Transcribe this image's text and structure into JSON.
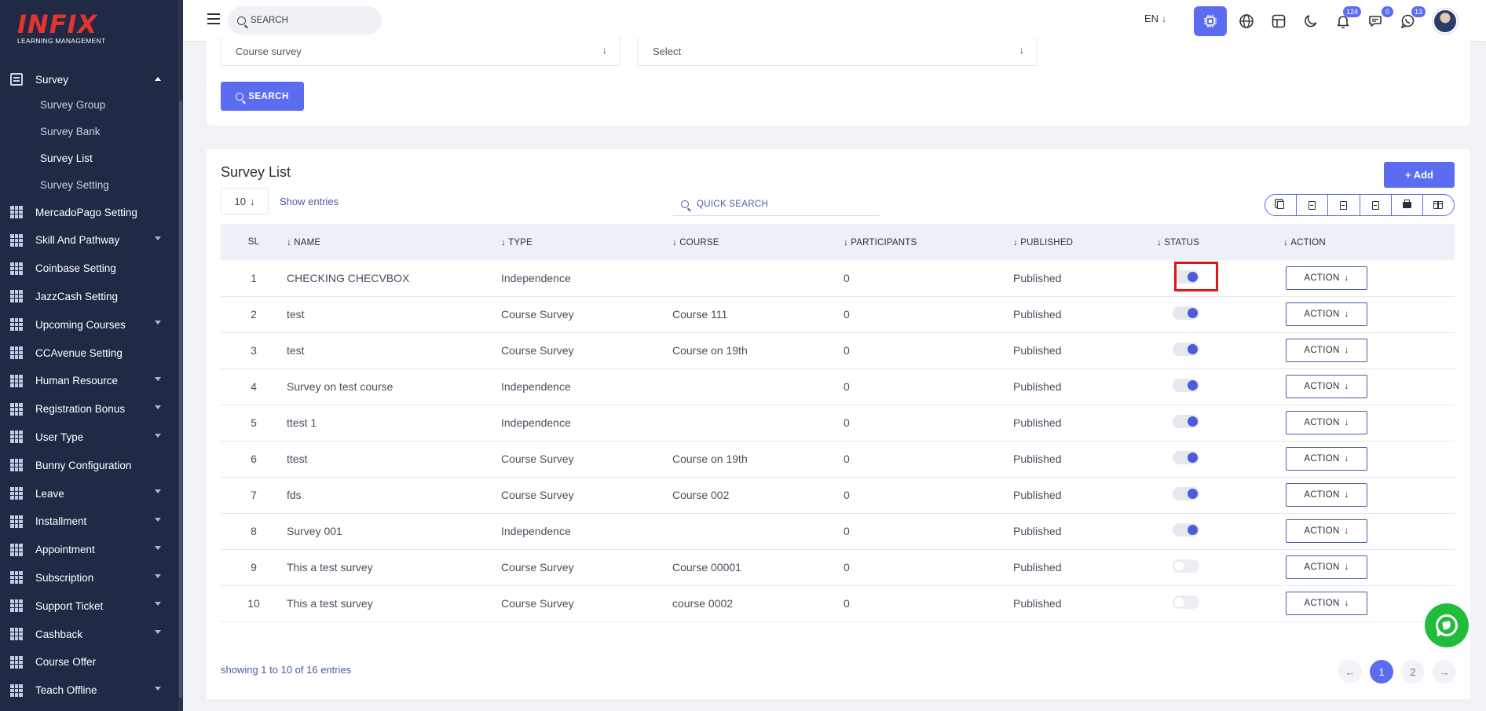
{
  "brand": {
    "name": "INFIX",
    "tagline": "LEARNING MANAGEMENT"
  },
  "sidebar": {
    "group": {
      "label": "Survey",
      "icon": "document-icon"
    },
    "sub_items": [
      {
        "label": "Survey Group",
        "active": false
      },
      {
        "label": "Survey Bank",
        "active": false
      },
      {
        "label": "Survey List",
        "active": true
      },
      {
        "label": "Survey Setting",
        "active": false
      }
    ],
    "items": [
      {
        "label": "MercadoPago Setting",
        "has_caret": false
      },
      {
        "label": "Skill And Pathway",
        "has_caret": true
      },
      {
        "label": "Coinbase Setting",
        "has_caret": false
      },
      {
        "label": "JazzCash Setting",
        "has_caret": false
      },
      {
        "label": "Upcoming Courses",
        "has_caret": true
      },
      {
        "label": "CCAvenue Setting",
        "has_caret": false
      },
      {
        "label": "Human Resource",
        "has_caret": true
      },
      {
        "label": "Registration Bonus",
        "has_caret": true
      },
      {
        "label": "User Type",
        "has_caret": true
      },
      {
        "label": "Bunny Configuration",
        "has_caret": false
      },
      {
        "label": "Leave",
        "has_caret": true
      },
      {
        "label": "Installment",
        "has_caret": true
      },
      {
        "label": "Appointment",
        "has_caret": true
      },
      {
        "label": "Subscription",
        "has_caret": true
      },
      {
        "label": "Support Ticket",
        "has_caret": true
      },
      {
        "label": "Cashback",
        "has_caret": true
      },
      {
        "label": "Course Offer",
        "has_caret": false
      },
      {
        "label": "Teach Offline",
        "has_caret": true
      }
    ]
  },
  "header": {
    "search_placeholder": "SEARCH",
    "language": "EN",
    "language_arrow": "↓",
    "notifications_count": "124",
    "messages_count": "0",
    "whatsapp_count": "13"
  },
  "filter": {
    "course_select_value": "Course survey",
    "second_select_value": "Select",
    "select_arrow": "↓",
    "search_button": "SEARCH"
  },
  "list": {
    "title": "Survey List",
    "add_button": "+ Add",
    "entries_value": "10",
    "entries_arrow": "↓",
    "show_entries_label": "Show entries",
    "quick_search_placeholder": "QUICK SEARCH",
    "export_buttons": [
      "copy-icon",
      "csv-icon",
      "excel-icon",
      "pdf-icon",
      "print-icon",
      "columns-icon"
    ],
    "columns": {
      "sl": "SL",
      "name": "NAME",
      "type": "TYPE",
      "course": "COURSE",
      "participants": "PARTICIPANTS",
      "published": "PUBLISHED",
      "status": "STATUS",
      "action": "ACTION"
    },
    "sort_arrow": "↓",
    "action_label": "ACTION",
    "action_arrow": "↓",
    "rows": [
      {
        "sl": "1",
        "name": "CHECKING CHECVBOX",
        "type": "Independence",
        "course": "",
        "participants": "0",
        "published": "Published",
        "status_on": true
      },
      {
        "sl": "2",
        "name": "test",
        "type": "Course Survey",
        "course": "Course 111",
        "participants": "0",
        "published": "Published",
        "status_on": true
      },
      {
        "sl": "3",
        "name": "test",
        "type": "Course Survey",
        "course": "Course on 19th",
        "participants": "0",
        "published": "Published",
        "status_on": true
      },
      {
        "sl": "4",
        "name": "Survey on test course",
        "type": "Independence",
        "course": "",
        "participants": "0",
        "published": "Published",
        "status_on": true
      },
      {
        "sl": "5",
        "name": "ttest 1",
        "type": "Independence",
        "course": "",
        "participants": "0",
        "published": "Published",
        "status_on": true
      },
      {
        "sl": "6",
        "name": "ttest",
        "type": "Course Survey",
        "course": "Course on 19th",
        "participants": "0",
        "published": "Published",
        "status_on": true
      },
      {
        "sl": "7",
        "name": "fds",
        "type": "Course Survey",
        "course": "Course 002",
        "participants": "0",
        "published": "Published",
        "status_on": true
      },
      {
        "sl": "8",
        "name": "Survey 001",
        "type": "Independence",
        "course": "",
        "participants": "0",
        "published": "Published",
        "status_on": true
      },
      {
        "sl": "9",
        "name": "This a test survey",
        "type": "Course Survey",
        "course": "Course 00001",
        "participants": "0",
        "published": "Published",
        "status_on": false
      },
      {
        "sl": "10",
        "name": "This a test survey",
        "type": "Course Survey",
        "course": "course 0002",
        "participants": "0",
        "published": "Published",
        "status_on": false
      }
    ],
    "showing_text": "showing 1 to 10 of 16 entries",
    "pagination": {
      "prev": "←",
      "pages": [
        "1",
        "2"
      ],
      "current": "1",
      "next": "→"
    }
  },
  "colors": {
    "primary": "#5b6cf0",
    "sidebar_bg": "#202a44",
    "highlight": "#e3131b",
    "whatsapp": "#1fbd3a"
  }
}
